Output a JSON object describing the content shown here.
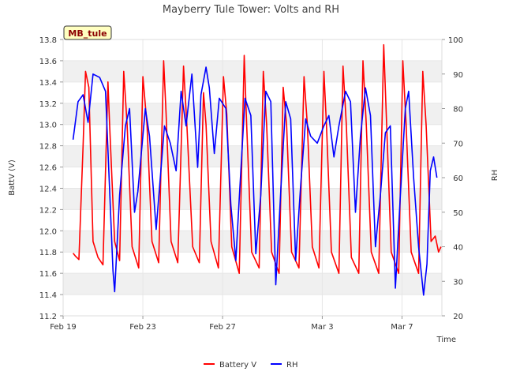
{
  "chart_data": {
    "type": "line",
    "title": "Mayberry Tule Tower: Volts and RH",
    "site_label": "MB_tule",
    "xlabel": "Time",
    "ylabel_left": "BattV (V)",
    "ylabel_right": "RH",
    "x_start": "2024-02-19",
    "x_end": "2024-03-09",
    "x_ticks": [
      {
        "date": "2024-02-19",
        "label": "Feb 19"
      },
      {
        "date": "2024-02-23",
        "label": "Feb 23"
      },
      {
        "date": "2024-02-27",
        "label": "Feb 27"
      },
      {
        "date": "2024-03-03",
        "label": "Mar 3"
      },
      {
        "date": "2024-03-07",
        "label": "Mar 7"
      }
    ],
    "ylim_left": [
      11.2,
      13.8
    ],
    "yticks_left": [
      "11.2",
      "11.4",
      "11.6",
      "11.8",
      "12.0",
      "12.2",
      "12.4",
      "12.6",
      "12.8",
      "13.0",
      "13.2",
      "13.4",
      "13.6",
      "13.8"
    ],
    "ylim_right": [
      20,
      100
    ],
    "yticks_right": [
      "20",
      "30",
      "40",
      "50",
      "60",
      "70",
      "80",
      "90",
      "100"
    ],
    "grid": "horizontal bands",
    "legend_position": "bottom",
    "series": [
      {
        "name": "Battery V",
        "axis": "left",
        "color": "#ff0000",
        "points": [
          [
            "2024-02-19 12:00",
            11.79
          ],
          [
            "2024-02-19 15:00",
            11.76
          ],
          [
            "2024-02-19 19:00",
            11.73
          ],
          [
            "2024-02-20 00:00",
            12.8
          ],
          [
            "2024-02-20 03:00",
            13.5
          ],
          [
            "2024-02-20 07:00",
            13.35
          ],
          [
            "2024-02-20 12:00",
            11.9
          ],
          [
            "2024-02-20 18:00",
            11.75
          ],
          [
            "2024-02-21 00:00",
            11.68
          ],
          [
            "2024-02-21 06:00",
            13.4
          ],
          [
            "2024-02-21 08:00",
            13.0
          ],
          [
            "2024-02-21 14:00",
            11.9
          ],
          [
            "2024-02-21 20:00",
            11.72
          ],
          [
            "2024-02-22 01:00",
            13.5
          ],
          [
            "2024-02-22 05:00",
            13.0
          ],
          [
            "2024-02-22 11:00",
            11.85
          ],
          [
            "2024-02-22 19:00",
            11.65
          ],
          [
            "2024-02-23 00:00",
            13.45
          ],
          [
            "2024-02-23 05:00",
            13.0
          ],
          [
            "2024-02-23 11:00",
            11.9
          ],
          [
            "2024-02-23 19:00",
            11.7
          ],
          [
            "2024-02-24 01:00",
            13.6
          ],
          [
            "2024-02-24 04:00",
            13.1
          ],
          [
            "2024-02-24 10:00",
            11.9
          ],
          [
            "2024-02-24 18:00",
            11.7
          ],
          [
            "2024-02-25 01:00",
            13.55
          ],
          [
            "2024-02-25 05:00",
            13.0
          ],
          [
            "2024-02-25 12:00",
            11.85
          ],
          [
            "2024-02-25 20:00",
            11.7
          ],
          [
            "2024-02-26 01:00",
            13.3
          ],
          [
            "2024-02-26 04:00",
            13.0
          ],
          [
            "2024-02-26 10:00",
            11.9
          ],
          [
            "2024-02-26 19:00",
            11.65
          ],
          [
            "2024-02-27 01:00",
            13.45
          ],
          [
            "2024-02-27 05:00",
            13.1
          ],
          [
            "2024-02-27 11:00",
            11.85
          ],
          [
            "2024-02-27 20:00",
            11.6
          ],
          [
            "2024-02-28 02:00",
            13.65
          ],
          [
            "2024-02-28 05:00",
            13.0
          ],
          [
            "2024-02-28 11:00",
            11.8
          ],
          [
            "2024-02-28 20:00",
            11.65
          ],
          [
            "2024-02-29 01:00",
            13.5
          ],
          [
            "2024-02-29 05:00",
            13.0
          ],
          [
            "2024-02-29 11:00",
            11.8
          ],
          [
            "2024-02-29 20:00",
            11.6
          ],
          [
            "2024-03-01 01:00",
            13.35
          ],
          [
            "2024-03-01 05:00",
            13.0
          ],
          [
            "2024-03-01 11:00",
            11.8
          ],
          [
            "2024-03-01 20:00",
            11.65
          ],
          [
            "2024-03-02 02:00",
            13.45
          ],
          [
            "2024-03-02 06:00",
            13.0
          ],
          [
            "2024-03-02 12:00",
            11.85
          ],
          [
            "2024-03-02 20:00",
            11.65
          ],
          [
            "2024-03-03 02:00",
            13.5
          ],
          [
            "2024-03-03 05:00",
            13.0
          ],
          [
            "2024-03-03 11:00",
            11.8
          ],
          [
            "2024-03-03 20:00",
            11.6
          ],
          [
            "2024-03-04 01:00",
            13.55
          ],
          [
            "2024-03-04 05:00",
            13.0
          ],
          [
            "2024-03-04 11:00",
            11.75
          ],
          [
            "2024-03-04 20:00",
            11.6
          ],
          [
            "2024-03-05 01:00",
            13.6
          ],
          [
            "2024-03-05 05:00",
            13.0
          ],
          [
            "2024-03-05 11:00",
            11.8
          ],
          [
            "2024-03-05 20:00",
            11.6
          ],
          [
            "2024-03-06 02:00",
            13.75
          ],
          [
            "2024-03-06 05:00",
            13.1
          ],
          [
            "2024-03-06 11:00",
            11.8
          ],
          [
            "2024-03-06 20:00",
            11.6
          ],
          [
            "2024-03-07 01:00",
            13.6
          ],
          [
            "2024-03-07 05:00",
            13.0
          ],
          [
            "2024-03-07 11:00",
            11.8
          ],
          [
            "2024-03-07 20:00",
            11.6
          ],
          [
            "2024-03-08 01:00",
            13.5
          ],
          [
            "2024-03-08 05:00",
            13.0
          ],
          [
            "2024-03-08 11:00",
            11.9
          ],
          [
            "2024-03-08 16:00",
            11.95
          ],
          [
            "2024-03-08 20:00",
            11.8
          ],
          [
            "2024-03-08 23:00",
            11.85
          ]
        ]
      },
      {
        "name": "RH",
        "axis": "right",
        "color": "#0000ff",
        "points": [
          [
            "2024-02-19 12:00",
            71
          ],
          [
            "2024-02-19 18:00",
            82
          ],
          [
            "2024-02-20 00:00",
            84
          ],
          [
            "2024-02-20 06:00",
            76
          ],
          [
            "2024-02-20 12:00",
            90
          ],
          [
            "2024-02-20 20:00",
            89
          ],
          [
            "2024-02-21 03:00",
            85
          ],
          [
            "2024-02-21 12:00",
            33
          ],
          [
            "2024-02-21 14:00",
            27
          ],
          [
            "2024-02-21 20:00",
            55
          ],
          [
            "2024-02-22 03:00",
            75
          ],
          [
            "2024-02-22 08:00",
            80
          ],
          [
            "2024-02-22 14:00",
            50
          ],
          [
            "2024-02-22 18:00",
            56
          ],
          [
            "2024-02-23 03:00",
            80
          ],
          [
            "2024-02-23 08:00",
            72
          ],
          [
            "2024-02-23 16:00",
            45
          ],
          [
            "2024-02-24 02:00",
            75
          ],
          [
            "2024-02-24 09:00",
            70
          ],
          [
            "2024-02-24 16:00",
            62
          ],
          [
            "2024-02-24 22:00",
            85
          ],
          [
            "2024-02-25 04:00",
            75
          ],
          [
            "2024-02-25 11:00",
            90
          ],
          [
            "2024-02-25 18:00",
            63
          ],
          [
            "2024-02-25 22:00",
            84
          ],
          [
            "2024-02-26 04:00",
            92
          ],
          [
            "2024-02-26 08:00",
            86
          ],
          [
            "2024-02-26 14:00",
            67
          ],
          [
            "2024-02-26 20:00",
            83
          ],
          [
            "2024-02-27 04:00",
            80
          ],
          [
            "2024-02-27 10:00",
            52
          ],
          [
            "2024-02-27 16:00",
            36
          ],
          [
            "2024-02-27 20:00",
            54
          ],
          [
            "2024-02-28 03:00",
            83
          ],
          [
            "2024-02-28 10:00",
            78
          ],
          [
            "2024-02-28 16:00",
            38
          ],
          [
            "2024-02-28 22:00",
            55
          ],
          [
            "2024-02-29 04:00",
            85
          ],
          [
            "2024-02-29 10:00",
            82
          ],
          [
            "2024-02-29 16:00",
            29
          ],
          [
            "2024-02-29 22:00",
            56
          ],
          [
            "2024-03-01 04:00",
            82
          ],
          [
            "2024-03-01 10:00",
            77
          ],
          [
            "2024-03-01 16:00",
            36
          ],
          [
            "2024-03-01 22:00",
            58
          ],
          [
            "2024-03-02 04:00",
            77
          ],
          [
            "2024-03-02 10:00",
            72
          ],
          [
            "2024-03-02 18:00",
            70
          ],
          [
            "2024-03-03 02:00",
            75
          ],
          [
            "2024-03-03 08:00",
            78
          ],
          [
            "2024-03-03 14:00",
            66
          ],
          [
            "2024-03-03 20:00",
            75
          ],
          [
            "2024-03-04 04:00",
            85
          ],
          [
            "2024-03-04 10:00",
            82
          ],
          [
            "2024-03-04 16:00",
            50
          ],
          [
            "2024-03-04 22:00",
            72
          ],
          [
            "2024-03-05 04:00",
            86
          ],
          [
            "2024-03-05 10:00",
            78
          ],
          [
            "2024-03-05 16:00",
            40
          ],
          [
            "2024-03-05 22:00",
            55
          ],
          [
            "2024-03-06 04:00",
            73
          ],
          [
            "2024-03-06 10:00",
            75
          ],
          [
            "2024-03-06 16:00",
            28
          ],
          [
            "2024-03-06 22:00",
            55
          ],
          [
            "2024-03-07 04:00",
            80
          ],
          [
            "2024-03-07 08:00",
            85
          ],
          [
            "2024-03-07 14:00",
            60
          ],
          [
            "2024-03-07 20:00",
            40
          ],
          [
            "2024-03-08 02:00",
            26
          ],
          [
            "2024-03-08 06:00",
            35
          ],
          [
            "2024-03-08 10:00",
            62
          ],
          [
            "2024-03-08 14:00",
            66
          ],
          [
            "2024-03-08 18:00",
            60
          ]
        ]
      }
    ]
  }
}
